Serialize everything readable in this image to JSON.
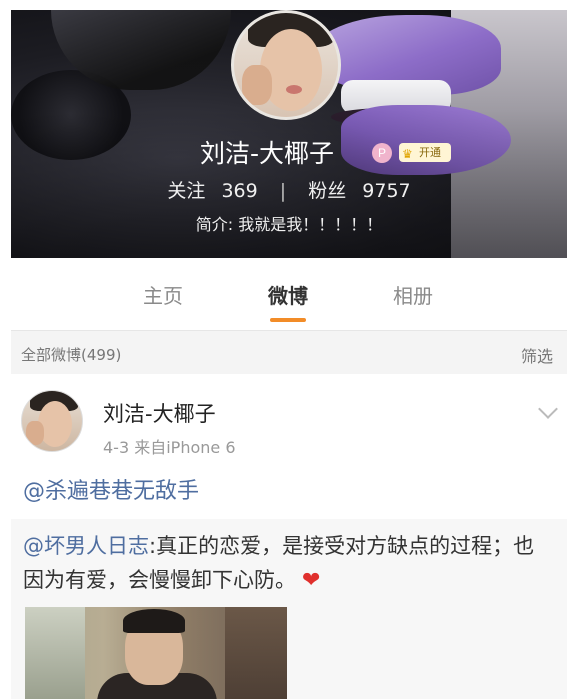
{
  "profile": {
    "name": "刘洁-大椰子",
    "badge_p": "P",
    "badge_vip": "开通",
    "following_label": "关注",
    "following_count": "369",
    "separator": "|",
    "followers_label": "粉丝",
    "followers_count": "9757",
    "bio": "简介: 我就是我！！！！！"
  },
  "tabs": {
    "home": "主页",
    "weibo": "微博",
    "album": "相册",
    "active": "weibo"
  },
  "filter": {
    "all_label": "全部微博(499)",
    "filter_button": "筛选"
  },
  "post": {
    "author": "刘洁-大椰子",
    "meta": "4-3  来自iPhone 6",
    "text": "@杀遍巷巷无敌手",
    "repost": {
      "mention": "@坏男人日志",
      "body": ":真正的恋爱，是接受对方缺点的过程；也因为有爱，会慢慢卸下心防。",
      "emoji": "❤"
    }
  },
  "colors": {
    "accent": "#f28c28",
    "link": "#4f6ea0",
    "heart": "#e0302d"
  }
}
